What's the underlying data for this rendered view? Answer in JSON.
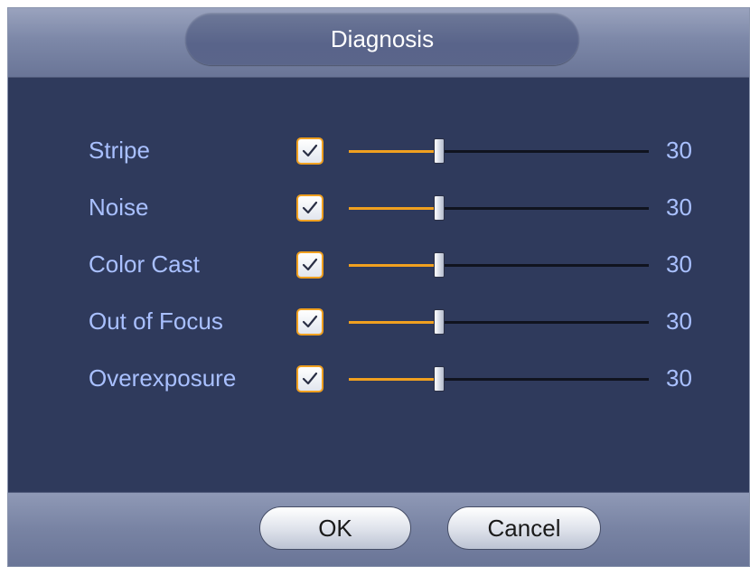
{
  "dialog": {
    "title": "Diagnosis"
  },
  "rows": [
    {
      "label": "Stripe",
      "checked": true,
      "value": "30",
      "level": 0.3
    },
    {
      "label": "Noise",
      "checked": true,
      "value": "30",
      "level": 0.3
    },
    {
      "label": "Color Cast",
      "checked": true,
      "value": "30",
      "level": 0.3
    },
    {
      "label": "Out of Focus",
      "checked": true,
      "value": "30",
      "level": 0.3
    },
    {
      "label": "Overexposure",
      "checked": true,
      "value": "30",
      "level": 0.3
    }
  ],
  "buttons": {
    "ok_label": "OK",
    "cancel_label": "Cancel"
  },
  "colors": {
    "accent": "#f0a020",
    "label_text": "#a9c0ff",
    "background": "#2f3a5c"
  },
  "icons": {
    "checkbox": "checkmark-icon"
  }
}
